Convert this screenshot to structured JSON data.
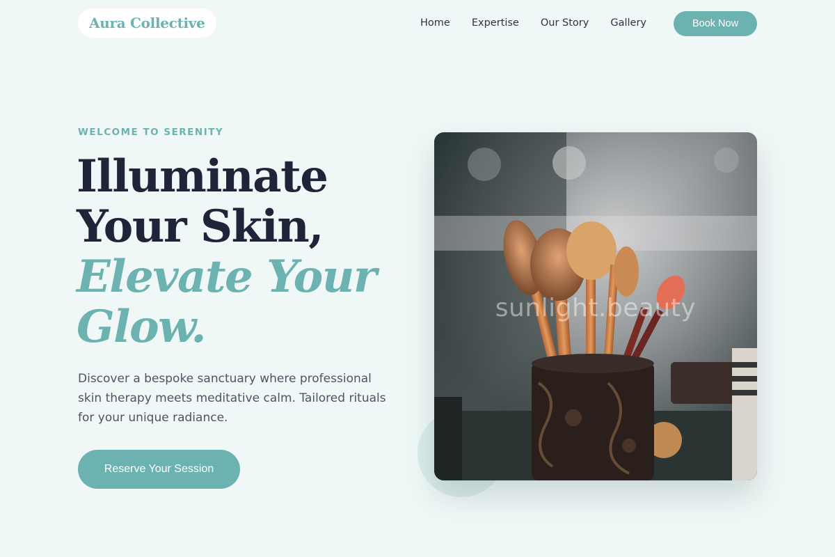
{
  "header": {
    "brand": "Aura Collective",
    "nav": [
      "Home",
      "Expertise",
      "Our Story",
      "Gallery"
    ],
    "book_label": "Book Now"
  },
  "hero": {
    "eyebrow": "WELCOME TO SERENITY",
    "headline_dark": [
      "Illuminate",
      "Your Skin,"
    ],
    "headline_accent": [
      "Elevate Your",
      "Glow."
    ],
    "description": "Discover a bespoke sanctuary where professional skin therapy meets meditative calm. Tailored rituals for your unique radiance.",
    "cta_label": "Reserve Your Session"
  },
  "image": {
    "watermark": "sunlight.beauty"
  },
  "colors": {
    "accent": "#6cb2b0",
    "background": "#eff8f7",
    "heading": "#1c2638",
    "body_text": "#4b5563"
  }
}
